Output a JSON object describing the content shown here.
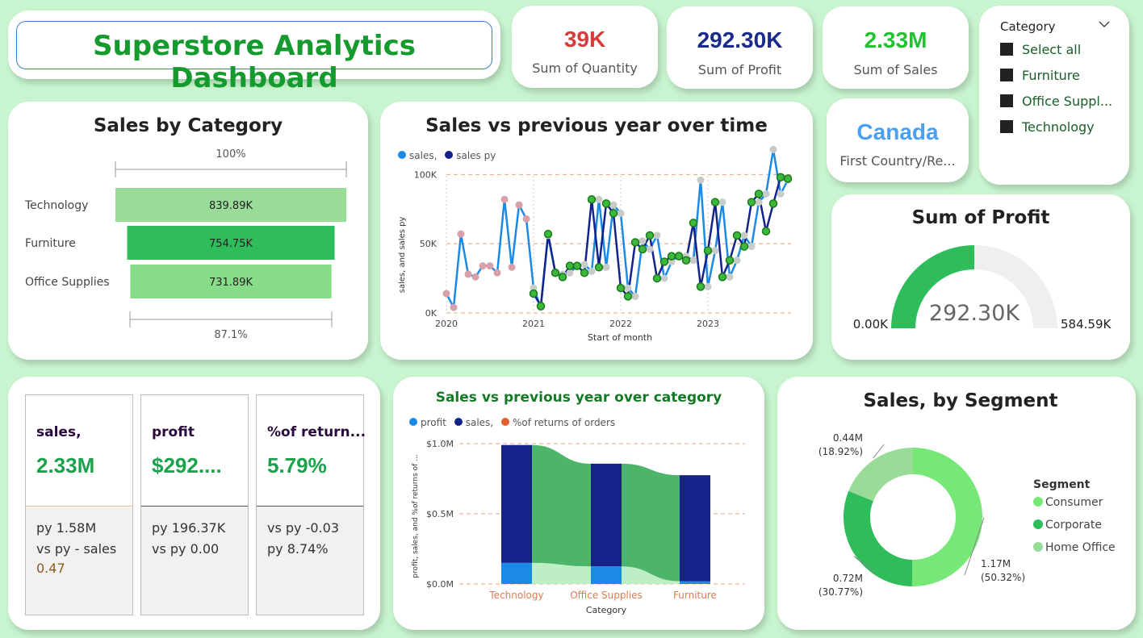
{
  "header": {
    "title": "Superstore Analytics Dashboard"
  },
  "kpis": {
    "quantity": {
      "value": "39K",
      "label": "Sum of Quantity",
      "color": "#d93a3a"
    },
    "profit": {
      "value": "292.30K",
      "label": "Sum of Profit",
      "color": "#1a2a8a"
    },
    "sales": {
      "value": "2.33M",
      "label": "Sum of Sales",
      "color": "#22c232"
    },
    "country": {
      "value": "Canada",
      "label": "First Country/Re...",
      "color": "#4aa0f0"
    }
  },
  "slicer": {
    "title": "Category",
    "items": [
      "Select all",
      "Furniture",
      "Office Suppl...",
      "Technology"
    ]
  },
  "sales_by_category": {
    "title": "Sales by Category",
    "top_pct": "100%",
    "bottom_pct": "87.1%",
    "chart_data": {
      "type": "bar",
      "categories": [
        "Technology",
        "Furniture",
        "Office Supplies"
      ],
      "values": [
        839.89,
        754.75,
        731.89
      ],
      "value_labels": [
        "839.89K",
        "754.75K",
        "731.89K"
      ],
      "colors": [
        "#98dc98",
        "#2ebd5a",
        "#87dc87"
      ]
    }
  },
  "sales_vs_py_time": {
    "title": "Sales vs previous year over time",
    "legend": [
      "sales,",
      "sales py"
    ],
    "xlabel": "Start of month",
    "ylabel": "sales, and sales py",
    "ytick_labels": [
      "100K",
      "50K",
      "0K"
    ],
    "xtick_labels": [
      "2020",
      "2021",
      "2022",
      "2023"
    ],
    "chart_data": {
      "type": "line",
      "x_start": "2020-01",
      "x_end": "2023-12",
      "ylim": [
        0,
        120000
      ],
      "series": [
        {
          "name": "sales,",
          "color": "#1a8ae6",
          "values": [
            14000,
            4000,
            57000,
            28000,
            26000,
            34000,
            34000,
            29000,
            82000,
            33000,
            78000,
            68000,
            18000,
            4000,
            56000,
            29000,
            28000,
            29000,
            34000,
            35000,
            30000,
            82000,
            33000,
            78000,
            72000,
            18000,
            12000,
            52000,
            46000,
            56000,
            25000,
            37000,
            42000,
            41000,
            38000,
            96000,
            19000,
            45000,
            80000,
            26000,
            38000,
            56000,
            48000,
            80000,
            86000,
            118000,
            86000,
            96000
          ]
        },
        {
          "name": "sales py",
          "color": "#14238a",
          "values": [
            null,
            null,
            null,
            null,
            null,
            null,
            null,
            null,
            null,
            null,
            null,
            null,
            14000,
            5000,
            57000,
            29000,
            26000,
            34000,
            34000,
            29000,
            82000,
            33000,
            79000,
            72000,
            18000,
            12000,
            51000,
            46000,
            56000,
            25000,
            37000,
            41000,
            41000,
            38000,
            65000,
            19000,
            45000,
            80000,
            26000,
            38000,
            56000,
            48000,
            80000,
            86000,
            59000,
            79000,
            98000,
            97000
          ]
        }
      ]
    }
  },
  "sum_of_profit_gauge": {
    "title": "Sum of Profit",
    "value": "292.30K",
    "min": "0.00K",
    "max": "584.59K",
    "chart_data": {
      "type": "gauge",
      "value": 292.3,
      "min": 0,
      "max": 584.59
    }
  },
  "multicards": [
    {
      "header": "sales,",
      "value": "2.33M",
      "lines": [
        "py 1.58M",
        "vs py - sales",
        "0.47"
      ]
    },
    {
      "header": "profit",
      "value": "$292....",
      "lines": [
        "py 196.37K",
        "vs py 0.00"
      ]
    },
    {
      "header": "%of return...",
      "value": "5.79%",
      "lines": [
        "vs py -0.03",
        "py 8.74%"
      ]
    }
  ],
  "ribbon": {
    "title": "Sales vs previous year over category",
    "legend": [
      "profit",
      "sales,",
      "%of returns of orders"
    ],
    "legend_colors": [
      "#1a8ae6",
      "#14238a",
      "#e06030"
    ],
    "xlabel": "Category",
    "ylabel": "profit, sales, and %of returns of ...",
    "ytick_labels": [
      "$1.0M",
      "$0.5M",
      "$0.0M"
    ],
    "chart_data": {
      "type": "bar",
      "categories": [
        "Technology",
        "Office Supplies",
        "Furniture"
      ],
      "ylim": [
        0,
        1000000
      ],
      "series": [
        {
          "name": "profit",
          "values": [
            150000,
            125000,
            20000
          ]
        },
        {
          "name": "sales,",
          "values": [
            840000,
            732000,
            755000
          ]
        }
      ]
    }
  },
  "segment": {
    "title": "Sales, by Segment",
    "legend_title": "Segment",
    "chart_data": {
      "type": "pie",
      "labels": [
        "Consumer",
        "Corporate",
        "Home Office"
      ],
      "values": [
        1.17,
        0.72,
        0.44
      ],
      "percent": [
        50.32,
        30.77,
        18.92
      ],
      "colors": [
        "#77e877",
        "#2ebd5a",
        "#98dc98"
      ],
      "value_labels": [
        "1.17M",
        "0.72M",
        "0.44M"
      ],
      "pct_labels": [
        "(50.32%)",
        "(30.77%)",
        "(18.92%)"
      ]
    }
  }
}
